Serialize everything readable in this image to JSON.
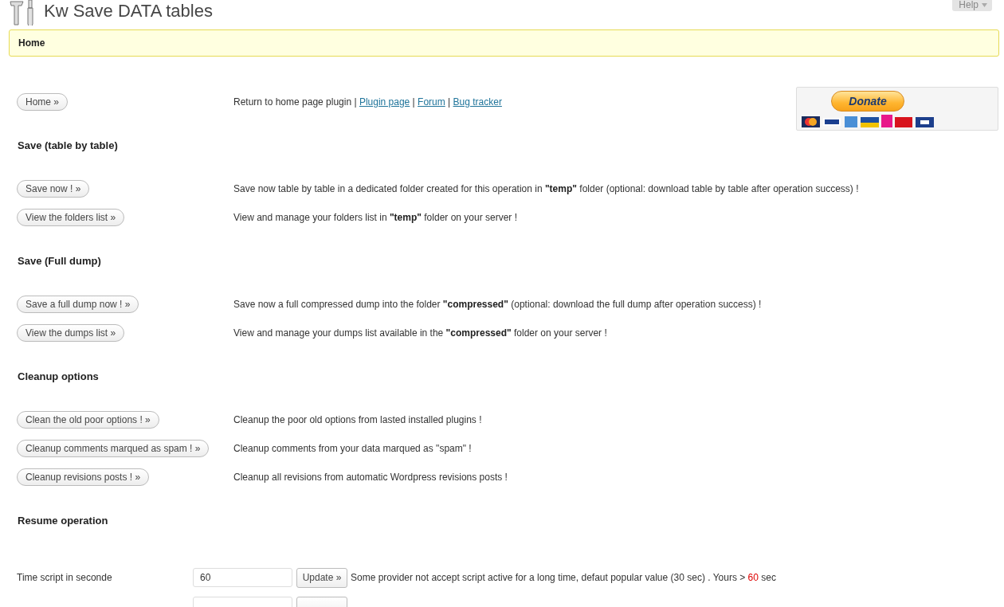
{
  "title": "Kw Save DATA tables",
  "help": {
    "label": "Help"
  },
  "notice": "Home",
  "home_row": {
    "button": "Home »",
    "description": [
      {
        "kind": "text",
        "text": "Return to home page plugin | "
      },
      {
        "kind": "link",
        "text": "Plugin page"
      },
      {
        "kind": "text",
        "text": " | "
      },
      {
        "kind": "link",
        "text": "Forum"
      },
      {
        "kind": "text",
        "text": " | "
      },
      {
        "kind": "link",
        "text": "Bug tracker"
      }
    ]
  },
  "donate": {
    "label": "Donate"
  },
  "sections": [
    {
      "heading": "Save (table by table)",
      "rows": [
        {
          "button": "Save now ! »",
          "description": "Save now table by table in a dedicated folder created for this operation in **\"temp\"** folder (optional: download table by table after operation success) !"
        },
        {
          "button": "View the folders list »",
          "description": "View and manage your folders list in **\"temp\"** folder on your server !"
        }
      ]
    },
    {
      "heading": "Save (Full dump)",
      "rows": [
        {
          "button": "Save a full dump now ! »",
          "description": "Save now a full compressed dump into the folder **\"compressed\"** (optional: download the full dump after operation success) !"
        },
        {
          "button": "View the dumps list »",
          "description": "View and manage your dumps list available in the **\"compressed\"** folder on your server !"
        }
      ]
    },
    {
      "heading": "Cleanup options",
      "rows": [
        {
          "button": "Clean the old poor options ! »",
          "description": "Cleanup the poor old options from lasted installed plugins !"
        },
        {
          "button": "Cleanup comments marqued as spam ! »",
          "description": "Cleanup comments from your data marqued as \"spam\" !"
        },
        {
          "button": "Cleanup revisions posts ! »",
          "description": "Cleanup all revisions from automatic Wordpress revisions posts !"
        }
      ]
    }
  ],
  "resume": {
    "heading": "Resume operation",
    "settings": [
      {
        "label": "Time script in seconde",
        "value": "60",
        "button": "Update »",
        "note": "Some provider not accept script active for a long time, defaut popular value (30 sec) . Yours > ",
        "highlight": "60",
        "suffix": " sec"
      }
    ]
  }
}
